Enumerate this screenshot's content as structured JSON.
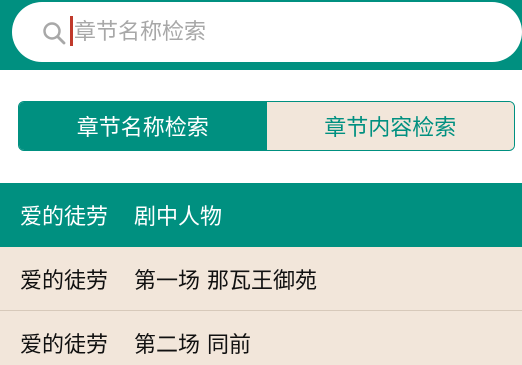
{
  "search": {
    "placeholder": "章节名称检索"
  },
  "segment": {
    "tabs": [
      {
        "label": "章节名称检索",
        "selected": true
      },
      {
        "label": "章节内容检索",
        "selected": false
      }
    ]
  },
  "list": {
    "header": {
      "book": "爱的徒劳",
      "chapter": "剧中人物"
    },
    "items": [
      {
        "book": "爱的徒劳",
        "chapter": "第一场 那瓦王御苑"
      },
      {
        "book": "爱的徒劳",
        "chapter": "第二场 同前"
      }
    ]
  },
  "colors": {
    "accent": "#009080",
    "panel": "#f2e6da",
    "caret": "#c0392b"
  },
  "icons": {
    "search": "search-icon"
  }
}
